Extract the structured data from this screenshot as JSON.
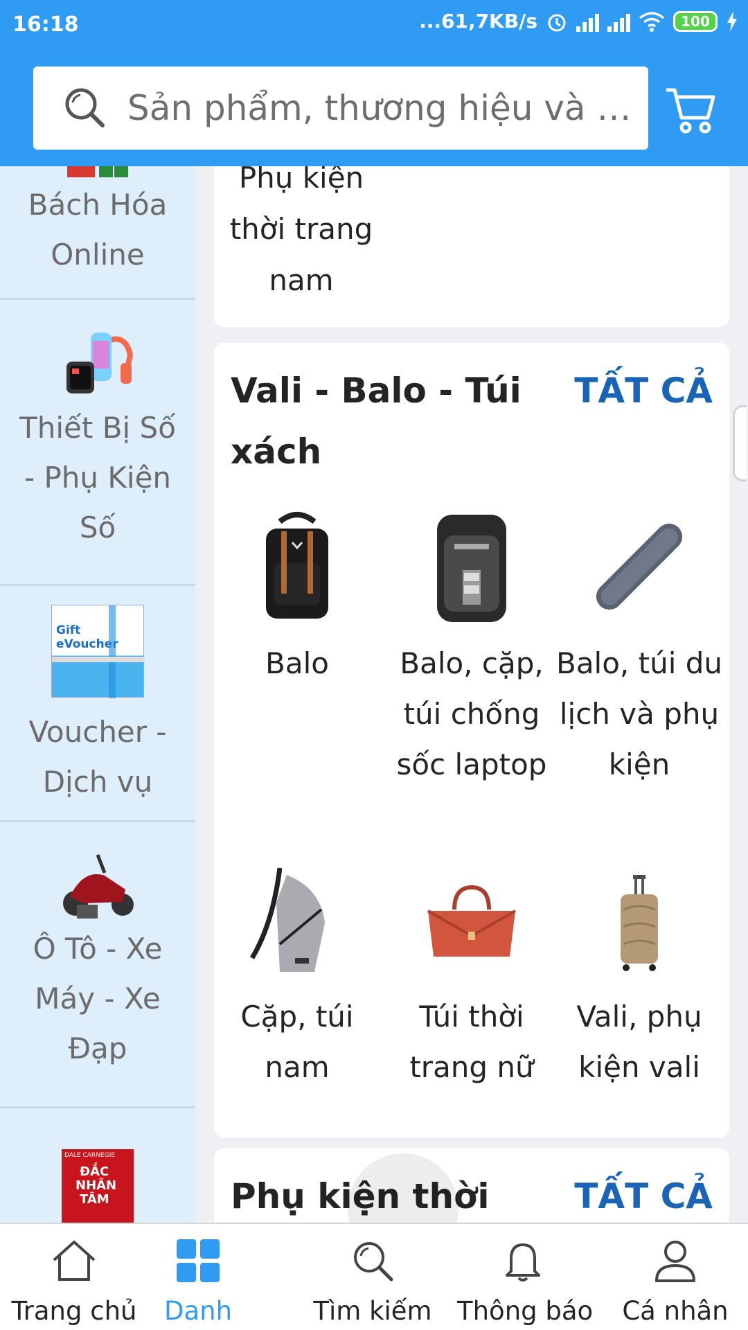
{
  "status_bar": {
    "time": "16:18",
    "network_speed": "...61,7KB/s",
    "battery": "100"
  },
  "search": {
    "placeholder": "Sản phẩm, thương hiệu và m..."
  },
  "sidebar": {
    "items": [
      {
        "label_lines": [
          "Bách Hóa",
          "Online"
        ],
        "icon": "beverage-pack-image"
      },
      {
        "label_lines": [
          "Thiết Bị Số",
          "- Phụ Kiện",
          "Số"
        ],
        "icon": "smartwatch-headphones-image"
      },
      {
        "label_lines": [
          "Voucher -",
          "Dịch vụ"
        ],
        "icon": "gift-evoucher-image",
        "badge_lines": [
          "Gift",
          "eVoucher"
        ]
      },
      {
        "label_lines": [
          "Ô Tô - Xe",
          "Máy - Xe",
          "Đạp"
        ],
        "icon": "motorbike-image"
      },
      {
        "label_lines": [],
        "icon": "book-cover-image",
        "badge_lines": [
          "DALE CARNEGIE",
          "ĐẮC",
          "NHÂN",
          "TÂM"
        ]
      }
    ]
  },
  "main": {
    "prev_section": {
      "subcategory_lines": [
        "Phụ kiện",
        "thời trang",
        "nam"
      ]
    },
    "section": {
      "title": "Vali - Balo - Túi xách",
      "all_label": "TẤT CẢ",
      "items": [
        {
          "label": "Balo",
          "icon": "black-backpack-image"
        },
        {
          "label": "Balo, cặp, túi chống sốc laptop",
          "icon": "laptop-backpack-image"
        },
        {
          "label": "Balo, túi du lịch và phụ kiện",
          "icon": "travel-pouch-image"
        },
        {
          "label": "Cặp, túi nam",
          "icon": "sling-bag-image"
        },
        {
          "label": "Túi thời trang nữ",
          "icon": "handbag-image"
        },
        {
          "label": "Vali, phụ kiện vali",
          "icon": "suitcase-image"
        }
      ]
    },
    "next_section": {
      "title": "Phụ kiện thời",
      "all_label": "TẤT CẢ"
    }
  },
  "bottom_nav": {
    "items": [
      {
        "label": "Trang chủ",
        "icon": "home-icon"
      },
      {
        "label": "Danh",
        "icon": "grid-icon",
        "active": true
      },
      {
        "label": "Tìm kiếm",
        "icon": "search-icon"
      },
      {
        "label": "Thông báo",
        "icon": "bell-icon"
      },
      {
        "label": "Cá nhân",
        "icon": "person-icon"
      }
    ]
  },
  "colors": {
    "header": "#2f9bf3",
    "accent": "#1a64b5",
    "sidebar_bg": "#dfeefb",
    "active_nav": "#2f9bf3"
  }
}
